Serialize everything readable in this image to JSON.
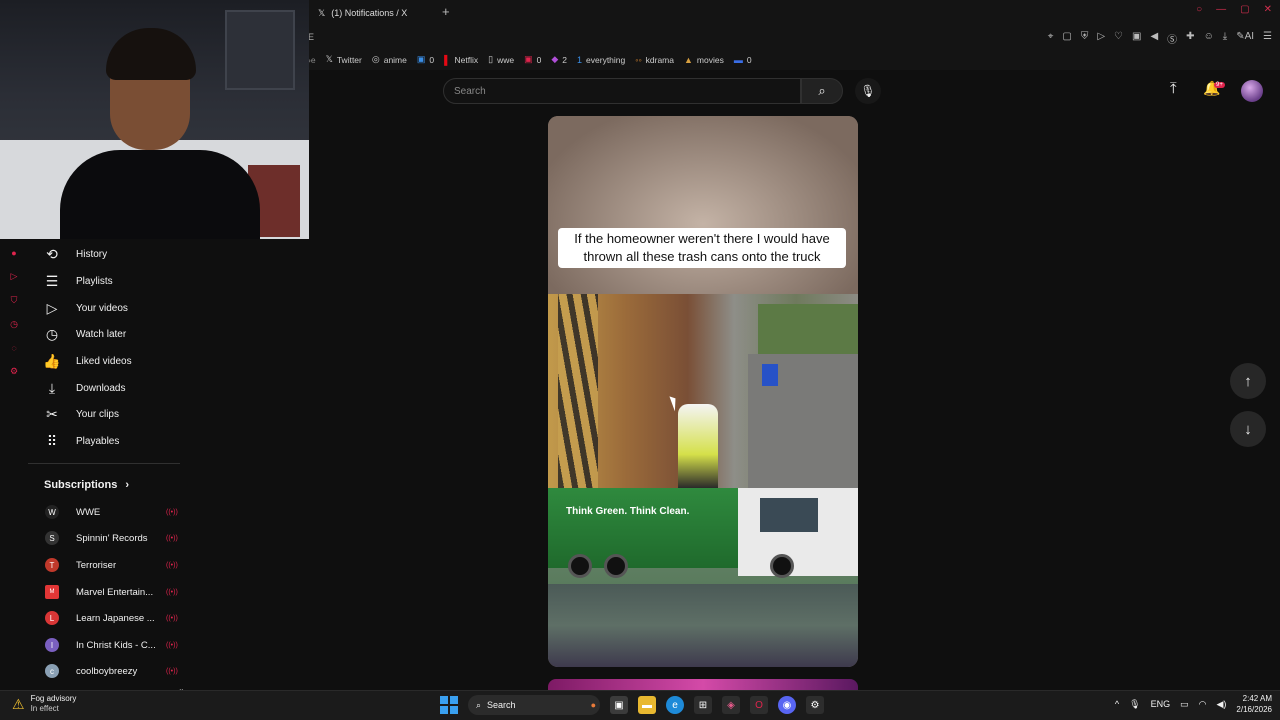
{
  "browser": {
    "tab_title": "(1) Notifications / X",
    "address_fragment": "E",
    "bookmarks": [
      {
        "icon": "twitter-icon",
        "glyph": "𝕏",
        "label": "Twitter"
      },
      {
        "icon": "anime-icon",
        "glyph": "◎",
        "label": "anime"
      },
      {
        "icon": "app-icon",
        "glyph": "▣",
        "label": "0"
      },
      {
        "icon": "netflix-icon",
        "glyph": "▌",
        "label": "Netflix"
      },
      {
        "icon": "page-icon",
        "glyph": "▯",
        "label": "wwe"
      },
      {
        "icon": "app-icon",
        "glyph": "▣",
        "label": "0"
      },
      {
        "icon": "app-icon",
        "glyph": "◆",
        "label": "2"
      },
      {
        "icon": "link-icon",
        "glyph": "1",
        "label": "everything"
      },
      {
        "icon": "kdrama-icon",
        "glyph": "◦◦",
        "label": "kdrama"
      },
      {
        "icon": "movies-icon",
        "glyph": "▲",
        "label": "movies"
      },
      {
        "icon": "app-icon",
        "glyph": "▬",
        "label": "0"
      }
    ]
  },
  "sidebar": {
    "items": [
      {
        "icon": "history-icon",
        "glyph": "⟲",
        "label": "History"
      },
      {
        "icon": "playlists-icon",
        "glyph": "☰",
        "label": "Playlists"
      },
      {
        "icon": "your-videos-icon",
        "glyph": "▷",
        "label": "Your videos"
      },
      {
        "icon": "watch-later-icon",
        "glyph": "◷",
        "label": "Watch later"
      },
      {
        "icon": "like-icon",
        "glyph": "👍",
        "label": "Liked videos"
      },
      {
        "icon": "download-icon",
        "glyph": "⤓",
        "label": "Downloads"
      },
      {
        "icon": "scissors-icon",
        "glyph": "✂",
        "label": "Your clips"
      },
      {
        "icon": "playables-icon",
        "glyph": "⠿",
        "label": "Playables"
      }
    ],
    "subscriptions_title": "Subscriptions",
    "subscriptions": [
      {
        "name": "WWE",
        "color": "#222222"
      },
      {
        "name": "Spinnin' Records",
        "color": "#333333"
      },
      {
        "name": "Terroriser",
        "color": "#c0392b"
      },
      {
        "name": "Marvel Entertain...",
        "color": "#e23636"
      },
      {
        "name": "Learn Japanese ...",
        "color": "#d93636"
      },
      {
        "name": "In Christ Kids - C...",
        "color": "#7a5fc0"
      },
      {
        "name": "coolboybreezy",
        "color": "#8aa0b4"
      }
    ]
  },
  "header": {
    "search_placeholder": "Search",
    "notification_badge": "9+"
  },
  "video": {
    "caption": "If the homeowner weren't there I would have thrown all these trash cans onto the truck",
    "truck_text": "Think Green. Think Clean."
  },
  "taskbar": {
    "weather_title": "Fog advisory",
    "weather_sub": "In effect",
    "search_label": "Search",
    "language": "ENG",
    "time": "2:42 AM",
    "date": "2/16/2026"
  },
  "colors": {
    "accent": "#e0244d",
    "background": "#0f0f0f"
  }
}
